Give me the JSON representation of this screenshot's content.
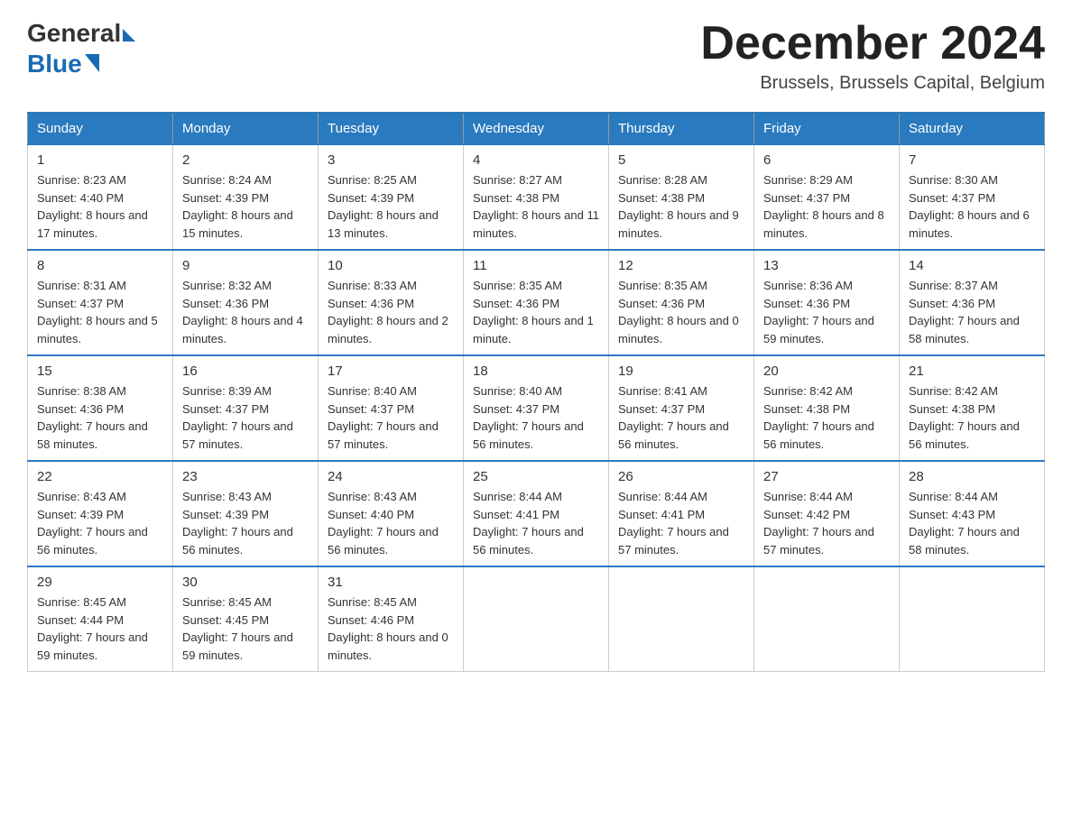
{
  "logo": {
    "general": "General",
    "blue": "Blue"
  },
  "title": "December 2024",
  "location": "Brussels, Brussels Capital, Belgium",
  "days_of_week": [
    "Sunday",
    "Monday",
    "Tuesday",
    "Wednesday",
    "Thursday",
    "Friday",
    "Saturday"
  ],
  "weeks": [
    [
      {
        "day": "1",
        "sunrise": "8:23 AM",
        "sunset": "4:40 PM",
        "daylight": "8 hours and 17 minutes."
      },
      {
        "day": "2",
        "sunrise": "8:24 AM",
        "sunset": "4:39 PM",
        "daylight": "8 hours and 15 minutes."
      },
      {
        "day": "3",
        "sunrise": "8:25 AM",
        "sunset": "4:39 PM",
        "daylight": "8 hours and 13 minutes."
      },
      {
        "day": "4",
        "sunrise": "8:27 AM",
        "sunset": "4:38 PM",
        "daylight": "8 hours and 11 minutes."
      },
      {
        "day": "5",
        "sunrise": "8:28 AM",
        "sunset": "4:38 PM",
        "daylight": "8 hours and 9 minutes."
      },
      {
        "day": "6",
        "sunrise": "8:29 AM",
        "sunset": "4:37 PM",
        "daylight": "8 hours and 8 minutes."
      },
      {
        "day": "7",
        "sunrise": "8:30 AM",
        "sunset": "4:37 PM",
        "daylight": "8 hours and 6 minutes."
      }
    ],
    [
      {
        "day": "8",
        "sunrise": "8:31 AM",
        "sunset": "4:37 PM",
        "daylight": "8 hours and 5 minutes."
      },
      {
        "day": "9",
        "sunrise": "8:32 AM",
        "sunset": "4:36 PM",
        "daylight": "8 hours and 4 minutes."
      },
      {
        "day": "10",
        "sunrise": "8:33 AM",
        "sunset": "4:36 PM",
        "daylight": "8 hours and 2 minutes."
      },
      {
        "day": "11",
        "sunrise": "8:35 AM",
        "sunset": "4:36 PM",
        "daylight": "8 hours and 1 minute."
      },
      {
        "day": "12",
        "sunrise": "8:35 AM",
        "sunset": "4:36 PM",
        "daylight": "8 hours and 0 minutes."
      },
      {
        "day": "13",
        "sunrise": "8:36 AM",
        "sunset": "4:36 PM",
        "daylight": "7 hours and 59 minutes."
      },
      {
        "day": "14",
        "sunrise": "8:37 AM",
        "sunset": "4:36 PM",
        "daylight": "7 hours and 58 minutes."
      }
    ],
    [
      {
        "day": "15",
        "sunrise": "8:38 AM",
        "sunset": "4:36 PM",
        "daylight": "7 hours and 58 minutes."
      },
      {
        "day": "16",
        "sunrise": "8:39 AM",
        "sunset": "4:37 PM",
        "daylight": "7 hours and 57 minutes."
      },
      {
        "day": "17",
        "sunrise": "8:40 AM",
        "sunset": "4:37 PM",
        "daylight": "7 hours and 57 minutes."
      },
      {
        "day": "18",
        "sunrise": "8:40 AM",
        "sunset": "4:37 PM",
        "daylight": "7 hours and 56 minutes."
      },
      {
        "day": "19",
        "sunrise": "8:41 AM",
        "sunset": "4:37 PM",
        "daylight": "7 hours and 56 minutes."
      },
      {
        "day": "20",
        "sunrise": "8:42 AM",
        "sunset": "4:38 PM",
        "daylight": "7 hours and 56 minutes."
      },
      {
        "day": "21",
        "sunrise": "8:42 AM",
        "sunset": "4:38 PM",
        "daylight": "7 hours and 56 minutes."
      }
    ],
    [
      {
        "day": "22",
        "sunrise": "8:43 AM",
        "sunset": "4:39 PM",
        "daylight": "7 hours and 56 minutes."
      },
      {
        "day": "23",
        "sunrise": "8:43 AM",
        "sunset": "4:39 PM",
        "daylight": "7 hours and 56 minutes."
      },
      {
        "day": "24",
        "sunrise": "8:43 AM",
        "sunset": "4:40 PM",
        "daylight": "7 hours and 56 minutes."
      },
      {
        "day": "25",
        "sunrise": "8:44 AM",
        "sunset": "4:41 PM",
        "daylight": "7 hours and 56 minutes."
      },
      {
        "day": "26",
        "sunrise": "8:44 AM",
        "sunset": "4:41 PM",
        "daylight": "7 hours and 57 minutes."
      },
      {
        "day": "27",
        "sunrise": "8:44 AM",
        "sunset": "4:42 PM",
        "daylight": "7 hours and 57 minutes."
      },
      {
        "day": "28",
        "sunrise": "8:44 AM",
        "sunset": "4:43 PM",
        "daylight": "7 hours and 58 minutes."
      }
    ],
    [
      {
        "day": "29",
        "sunrise": "8:45 AM",
        "sunset": "4:44 PM",
        "daylight": "7 hours and 59 minutes."
      },
      {
        "day": "30",
        "sunrise": "8:45 AM",
        "sunset": "4:45 PM",
        "daylight": "7 hours and 59 minutes."
      },
      {
        "day": "31",
        "sunrise": "8:45 AM",
        "sunset": "4:46 PM",
        "daylight": "8 hours and 0 minutes."
      },
      null,
      null,
      null,
      null
    ]
  ]
}
